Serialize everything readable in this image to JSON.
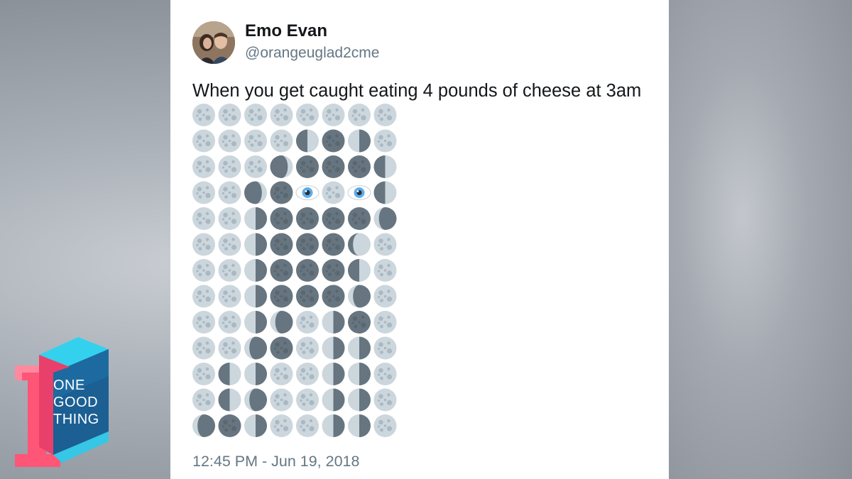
{
  "tweet": {
    "author_name": "Emo Evan",
    "author_handle": "@orangeuglad2cme",
    "text": "When you get caught eating 4 pounds of cheese at 3am",
    "timestamp": "12:45 PM - Jun 19, 2018"
  },
  "emoji_grid": {
    "description_codes": {
      "F": "full-moon",
      "N": "new-moon",
      "W": "waxing-gibbous",
      "G": "waning-gibbous",
      "C": "waxing-crescent",
      "R": "waning-crescent",
      "L": "first-quarter",
      "Q": "last-quarter",
      "E": "eye"
    },
    "rows": [
      "FFFFFFFF",
      "FFFFLNQF",
      "FFFCNNNL",
      "FFCNEFEL",
      "FFQNNNNR",
      "FFQNNNWF",
      "FFQNNNLF",
      "FFQNNNRF",
      "FFQRFQNF",
      "FFRNFQQF",
      "FLQFFQQF",
      "FLRFFQQF",
      "RNQFFQQF"
    ],
    "colors": {
      "moon_light": "#ccd6dd",
      "moon_crater": "#aab8c2",
      "moon_dark": "#66757f",
      "eye_white": "#ffffff",
      "eye_iris": "#5dadec",
      "eye_pupil": "#292f33"
    }
  },
  "logo": {
    "lines": [
      "ONE",
      "GOOD",
      "THING"
    ],
    "colors": {
      "top": "#2ec7e8",
      "side": "#ff4b6e",
      "front": "#1a5a8a"
    }
  }
}
